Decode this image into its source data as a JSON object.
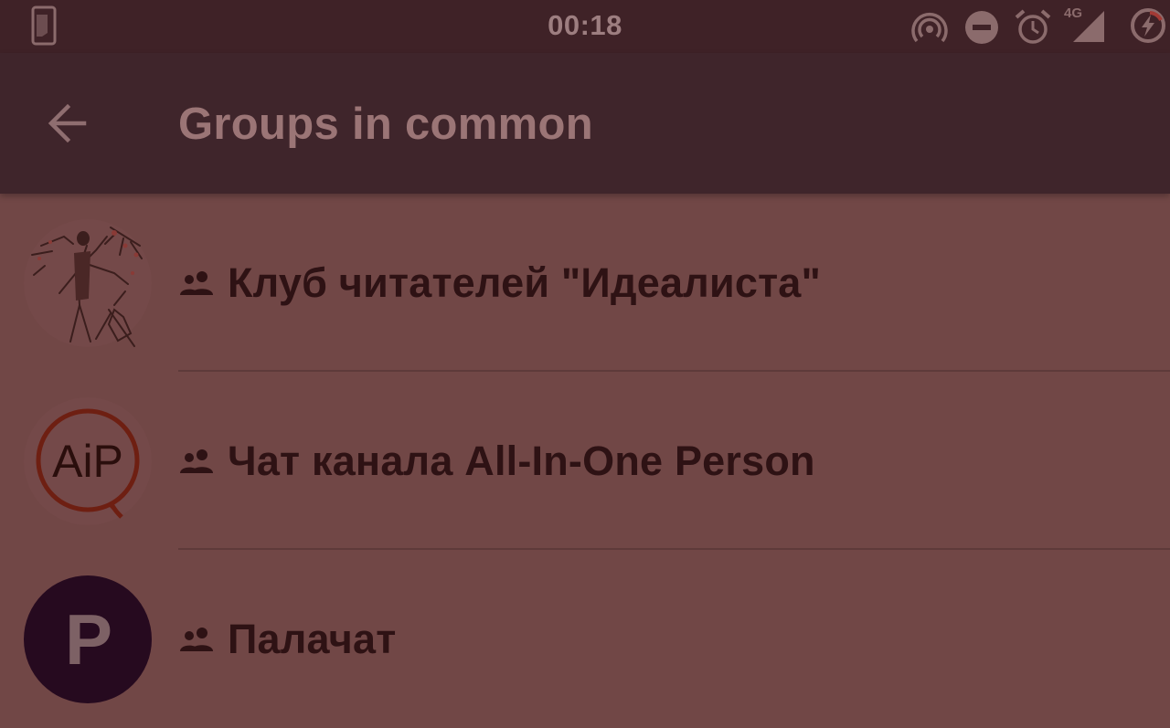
{
  "status_bar": {
    "time": "00:18",
    "network_label": "4G",
    "icons": [
      "sim-card-icon",
      "hotspot-icon",
      "do-not-disturb-icon",
      "alarm-icon",
      "signal-4g-icon",
      "battery-charging-icon"
    ]
  },
  "app_bar": {
    "title": "Groups in common",
    "back_icon": "arrow-back-icon"
  },
  "groups": [
    {
      "name": "Клуб читателей \"Идеалиста\"",
      "type_icon": "group-icon",
      "avatar": "illustration"
    },
    {
      "name": "Чат канала All-In-One Person",
      "type_icon": "group-icon",
      "avatar": "AiP"
    },
    {
      "name": "Палачат",
      "type_icon": "group-icon",
      "avatar": "P"
    }
  ],
  "colors": {
    "status_bar": "#3f2227",
    "app_bar": "#3f252b",
    "list_background": "#714746",
    "title_text": "#9b7576",
    "item_text": "#2e1214",
    "divider": "#5e3a3a",
    "aip_logo": "#6e1f12",
    "palachat_avatar": "#260a1f"
  }
}
